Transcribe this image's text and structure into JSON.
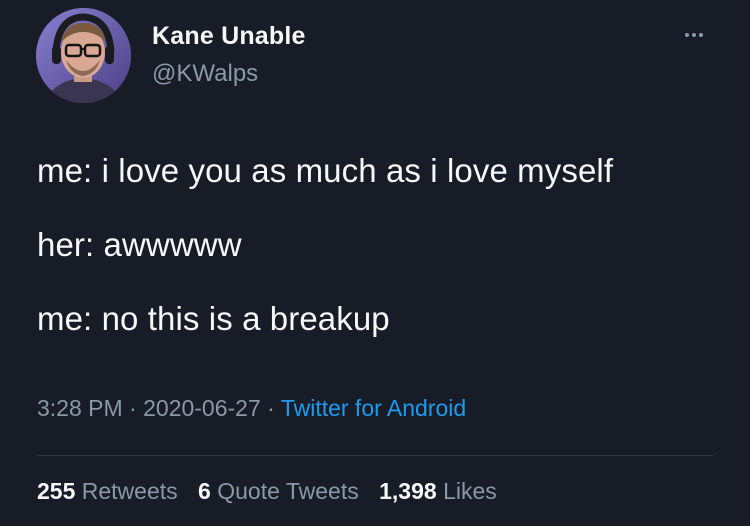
{
  "author": {
    "display_name": "Kane Unable",
    "handle": "@KWalps",
    "avatar_icon": "user-avatar-photo",
    "more_icon": "more-options-icon"
  },
  "tweet": {
    "lines": [
      "me: i love you as much as i love myself",
      "her: awwwww",
      "me: no this is a breakup"
    ]
  },
  "meta": {
    "time": "3:28 PM",
    "separator": "·",
    "date": "2020-06-27",
    "source": "Twitter for Android"
  },
  "stats": {
    "retweets": {
      "count": "255",
      "label": "Retweets"
    },
    "quote_tweets": {
      "count": "6",
      "label": "Quote Tweets"
    },
    "likes": {
      "count": "1,398",
      "label": "Likes"
    }
  },
  "colors": {
    "background": "#171c26",
    "primary_text": "#f5f7f8",
    "secondary_text": "#8b98a5",
    "link": "#1d9bf0"
  }
}
